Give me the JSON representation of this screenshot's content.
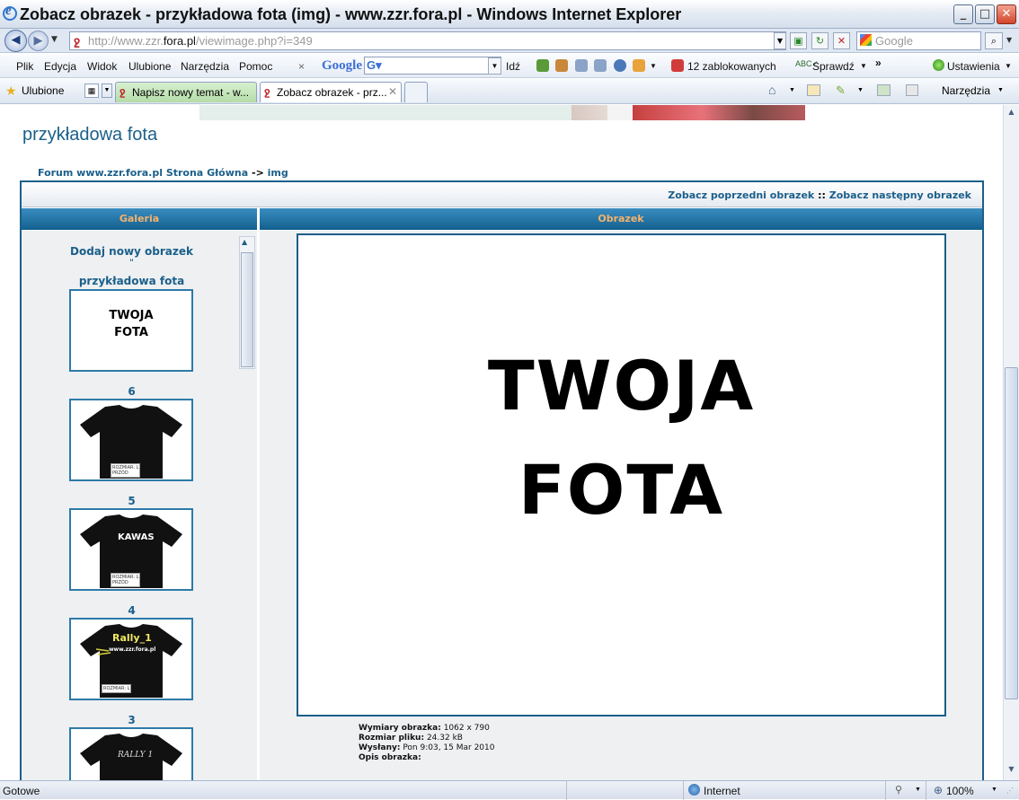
{
  "window": {
    "title": "Zobacz obrazek - przykładowa fota (img) - www.zzr.fora.pl - Windows Internet Explorer",
    "minimize": "_",
    "maximize": "□",
    "close": "✕"
  },
  "address": {
    "url_prefix": "http://www.zzr.",
    "url_domain": "fora.pl",
    "url_suffix": "/viewimage.php?i=349",
    "search_placeholder": "Google"
  },
  "menu": {
    "items": [
      "Plik",
      "Edycja",
      "Widok",
      "Ulubione",
      "Narzędzia",
      "Pomoc"
    ],
    "google": "Google",
    "go": "Idź",
    "blocked": "12 zablokowanych",
    "check": "Sprawdź",
    "more": "»",
    "settings": "Ustawienia"
  },
  "favorites": {
    "label": "Ulubione",
    "tabs": [
      "Napisz nowy temat - w...",
      "Zobacz obrazek - prz..."
    ],
    "tools": "Narzędzia"
  },
  "page": {
    "site_title": "przykładowa fota",
    "breadcrumb": {
      "home": "Forum www.zzr.fora.pl Strona Główna",
      "sep": "->",
      "current": "img"
    },
    "nav": {
      "prev": "Zobacz poprzedni obrazek",
      "sep": "::",
      "next": "Zobacz następny obrazek"
    },
    "headers": {
      "gallery": "Galeria",
      "image": "Obrazek"
    },
    "gallery": {
      "add_new": "Dodaj nowy obrazek",
      "bullet": "\"",
      "items": [
        {
          "caption": "przykładowa fota",
          "thumb_line1": "TWOJA",
          "thumb_line2": "FOTA"
        },
        {
          "caption": "6",
          "shirt_text": "",
          "tag1": "ROZMIAR: L",
          "tag2": "PRZÓD"
        },
        {
          "caption": "5",
          "shirt_text": "KAWAS",
          "tag1": "ROZMIAR: L",
          "tag2": "PRZÓD"
        },
        {
          "caption": "4",
          "shirt_text": "Rally_1",
          "shirt_sub": "www.zzr.fora.pl",
          "tag1": "ROZMIAR: L",
          "tag2": ""
        },
        {
          "caption": "3",
          "shirt_text": "RALLY 1"
        }
      ]
    },
    "image": {
      "line1": "TWOJA",
      "line2": "FOTA",
      "dimensions_label": "Wymiary obrazka:",
      "dimensions_value": "1062 x 790",
      "size_label": "Rozmiar pliku:",
      "size_value": "24.32 kB",
      "sent_label": "Wysłany:",
      "sent_value": "Pon 9:03, 15 Mar 2010",
      "desc_label": "Opis obrazka:",
      "desc_value": ""
    }
  },
  "status": {
    "left": "Gotowe",
    "zone": "Internet",
    "zoom": "100%"
  },
  "colors": {
    "link": "#1b5f8a",
    "header_text": "#f5b26b",
    "header_bg": "#12608f"
  }
}
